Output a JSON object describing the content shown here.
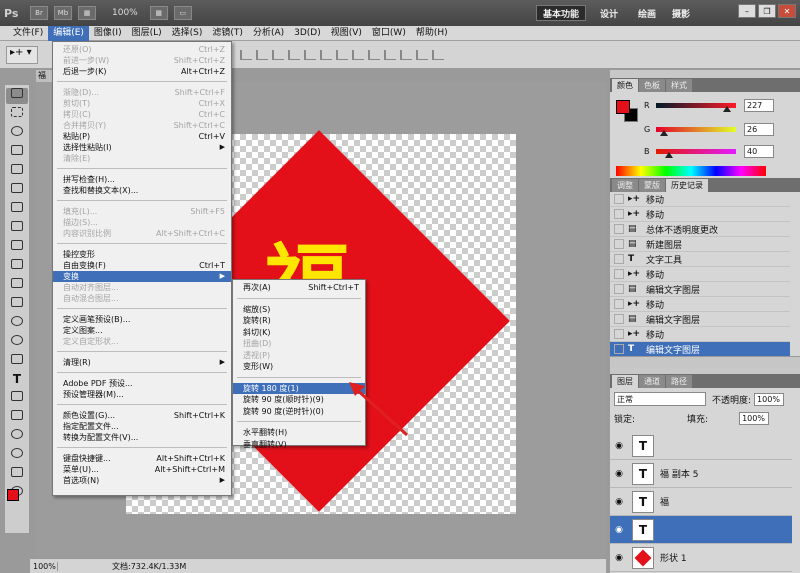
{
  "app": {
    "logo": "Ps",
    "zoom": "100%",
    "toolbar_icons": [
      "Br",
      "Mb"
    ],
    "workspaces": [
      "基本功能",
      "设计",
      "绘画",
      "摄影"
    ]
  },
  "menubar": [
    "文件(F)",
    "编辑(E)",
    "图像(I)",
    "图层(L)",
    "选择(S)",
    "滤镜(T)",
    "分析(A)",
    "3D(D)",
    "视图(V)",
    "窗口(W)",
    "帮助(H)"
  ],
  "edit_menu": [
    {
      "label": "还原(O)",
      "shortcut": "Ctrl+Z",
      "disabled": true
    },
    {
      "label": "前进一步(W)",
      "shortcut": "Shift+Ctrl+Z",
      "disabled": true
    },
    {
      "label": "后退一步(K)",
      "shortcut": "Alt+Ctrl+Z",
      "disabled": false
    },
    {
      "label": "渐隐(D)...",
      "shortcut": "Shift+Ctrl+F",
      "disabled": true
    },
    {
      "label": "剪切(T)",
      "shortcut": "Ctrl+X",
      "disabled": true
    },
    {
      "label": "拷贝(C)",
      "shortcut": "Ctrl+C",
      "disabled": true
    },
    {
      "label": "合并拷贝(Y)",
      "shortcut": "Shift+Ctrl+C",
      "disabled": true
    },
    {
      "label": "粘贴(P)",
      "shortcut": "Ctrl+V",
      "disabled": false
    },
    {
      "label": "选择性粘贴(I)",
      "shortcut": "",
      "disabled": false,
      "submenu": true
    },
    {
      "label": "清除(E)",
      "shortcut": "",
      "disabled": true
    },
    {
      "label": "拼写检查(H)...",
      "shortcut": "",
      "disabled": false
    },
    {
      "label": "查找和替换文本(X)...",
      "shortcut": "",
      "disabled": false
    },
    {
      "label": "填充(L)...",
      "shortcut": "Shift+F5",
      "disabled": true
    },
    {
      "label": "描边(S)...",
      "shortcut": "",
      "disabled": true
    },
    {
      "label": "内容识别比例",
      "shortcut": "Alt+Shift+Ctrl+C",
      "disabled": true
    },
    {
      "label": "操控变形",
      "shortcut": "",
      "disabled": false
    },
    {
      "label": "自由变换(F)",
      "shortcut": "Ctrl+T",
      "disabled": false
    },
    {
      "label": "变换",
      "shortcut": "",
      "disabled": false,
      "submenu": true,
      "highlighted": true
    },
    {
      "label": "自动对齐图层...",
      "shortcut": "",
      "disabled": true
    },
    {
      "label": "自动混合图层...",
      "shortcut": "",
      "disabled": true
    },
    {
      "label": "定义画笔预设(B)...",
      "shortcut": "",
      "disabled": false
    },
    {
      "label": "定义图案...",
      "shortcut": "",
      "disabled": false
    },
    {
      "label": "定义自定形状...",
      "shortcut": "",
      "disabled": true
    },
    {
      "label": "清理(R)",
      "shortcut": "",
      "disabled": false,
      "submenu": true
    },
    {
      "label": "Adobe PDF 预设...",
      "shortcut": "",
      "disabled": false
    },
    {
      "label": "预设管理器(M)...",
      "shortcut": "",
      "disabled": false
    },
    {
      "label": "颜色设置(G)...",
      "shortcut": "Shift+Ctrl+K",
      "disabled": false
    },
    {
      "label": "指定配置文件...",
      "shortcut": "",
      "disabled": false
    },
    {
      "label": "转换为配置文件(V)...",
      "shortcut": "",
      "disabled": false
    },
    {
      "label": "键盘快捷键...",
      "shortcut": "Alt+Shift+Ctrl+K",
      "disabled": false
    },
    {
      "label": "菜单(U)...",
      "shortcut": "Alt+Shift+Ctrl+M",
      "disabled": false
    },
    {
      "label": "首选项(N)",
      "shortcut": "",
      "disabled": false,
      "submenu": true
    }
  ],
  "transform_menu": [
    {
      "label": "再次(A)",
      "shortcut": "Shift+Ctrl+T",
      "disabled": false
    },
    {
      "label": "缩放(S)",
      "shortcut": "",
      "disabled": false
    },
    {
      "label": "旋转(R)",
      "shortcut": "",
      "disabled": false
    },
    {
      "label": "斜切(K)",
      "shortcut": "",
      "disabled": false
    },
    {
      "label": "扭曲(D)",
      "shortcut": "",
      "disabled": true
    },
    {
      "label": "透视(P)",
      "shortcut": "",
      "disabled": true
    },
    {
      "label": "变形(W)",
      "shortcut": "",
      "disabled": false
    },
    {
      "label": "旋转 180 度(1)",
      "shortcut": "",
      "disabled": false,
      "highlighted": true
    },
    {
      "label": "旋转 90 度(顺时针)(9)",
      "shortcut": "",
      "disabled": false
    },
    {
      "label": "旋转 90 度(逆时针)(0)",
      "shortcut": "",
      "disabled": false
    },
    {
      "label": "水平翻转(H)",
      "shortcut": "",
      "disabled": false
    },
    {
      "label": "垂直翻转(V)",
      "shortcut": "",
      "disabled": false
    }
  ],
  "color_panel": {
    "tabs": [
      "颜色",
      "色板",
      "样式"
    ],
    "r": "227",
    "g": "26",
    "b": "40",
    "r_fraction": 0.89,
    "g_fraction": 0.1,
    "b_fraction": 0.16
  },
  "history_panel": {
    "tabs": [
      "调整",
      "蒙版",
      "历史记录"
    ],
    "items": [
      {
        "icon": "move-icon",
        "label": "移动"
      },
      {
        "icon": "move-icon",
        "label": "移动"
      },
      {
        "icon": "history-state-icon",
        "label": "总体不透明度更改"
      },
      {
        "icon": "history-state-icon",
        "label": "新建图层"
      },
      {
        "icon": "type-icon",
        "label": "文字工具"
      },
      {
        "icon": "move-icon",
        "label": "移动"
      },
      {
        "icon": "history-state-icon",
        "label": "编辑文字图层"
      },
      {
        "icon": "move-icon",
        "label": "移动"
      },
      {
        "icon": "history-state-icon",
        "label": "编辑文字图层"
      },
      {
        "icon": "move-icon",
        "label": "移动"
      },
      {
        "icon": "type-icon",
        "label": "编辑文字图层",
        "selected": true
      }
    ]
  },
  "layers_panel": {
    "tabs": [
      "图层",
      "通道",
      "路径"
    ],
    "blend_mode": "正常",
    "opacity_label": "不透明度:",
    "opacity": "100%",
    "lock_label": "锁定:",
    "fill_label": "填充:",
    "fill": "100%",
    "layers": [
      {
        "name": "",
        "type": "text"
      },
      {
        "name": "福 副本 5",
        "type": "text"
      },
      {
        "name": "福",
        "type": "text"
      },
      {
        "name": "",
        "type": "text",
        "selected": true
      },
      {
        "name": "形状 1",
        "type": "shape"
      }
    ]
  },
  "status": {
    "zoom": "100%",
    "doc_info": "文档:732.4K/1.33M"
  },
  "colors": {
    "accent": "#3f6fb9",
    "foreground": "#e3101a",
    "background": "#000000"
  }
}
